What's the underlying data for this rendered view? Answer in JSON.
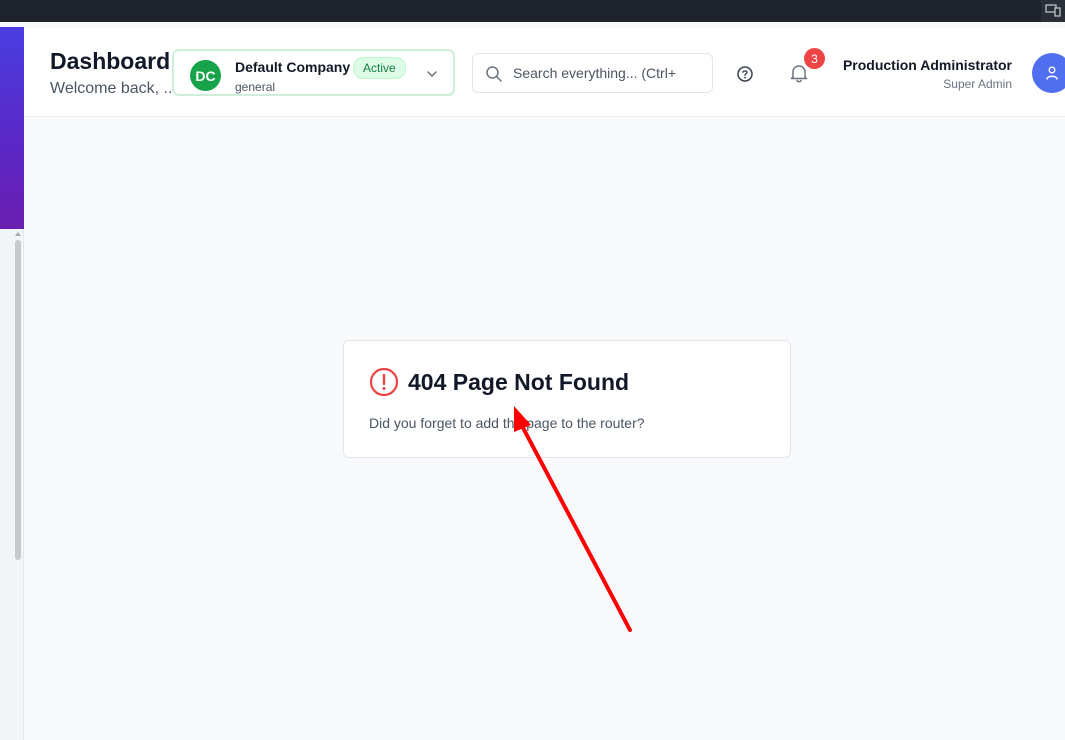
{
  "header": {
    "title": "Dashboard",
    "subtitle": "Welcome back, ..."
  },
  "company": {
    "initials": "DC",
    "name": "Default Company",
    "status": "Active",
    "type": "general"
  },
  "search": {
    "placeholder": "Search everything... (Ctrl+"
  },
  "notifications": {
    "count": "3"
  },
  "user": {
    "name": "Production Administrator",
    "role": "Super Admin"
  },
  "error_card": {
    "title": "404 Page Not Found",
    "message": "Did you forget to add the page to the router?"
  },
  "icons": {
    "help": "help-circle-icon",
    "bell": "bell-icon",
    "search": "search-icon",
    "chevron": "chevron-down-icon",
    "user": "user-icon",
    "error": "alert-circle-icon"
  },
  "colors": {
    "accent": "#4f6ef0",
    "company_avatar": "#16a34a",
    "error": "#ef4444",
    "badge_bg": "#dcfce7",
    "annotation_arrow": "#ff0000"
  }
}
